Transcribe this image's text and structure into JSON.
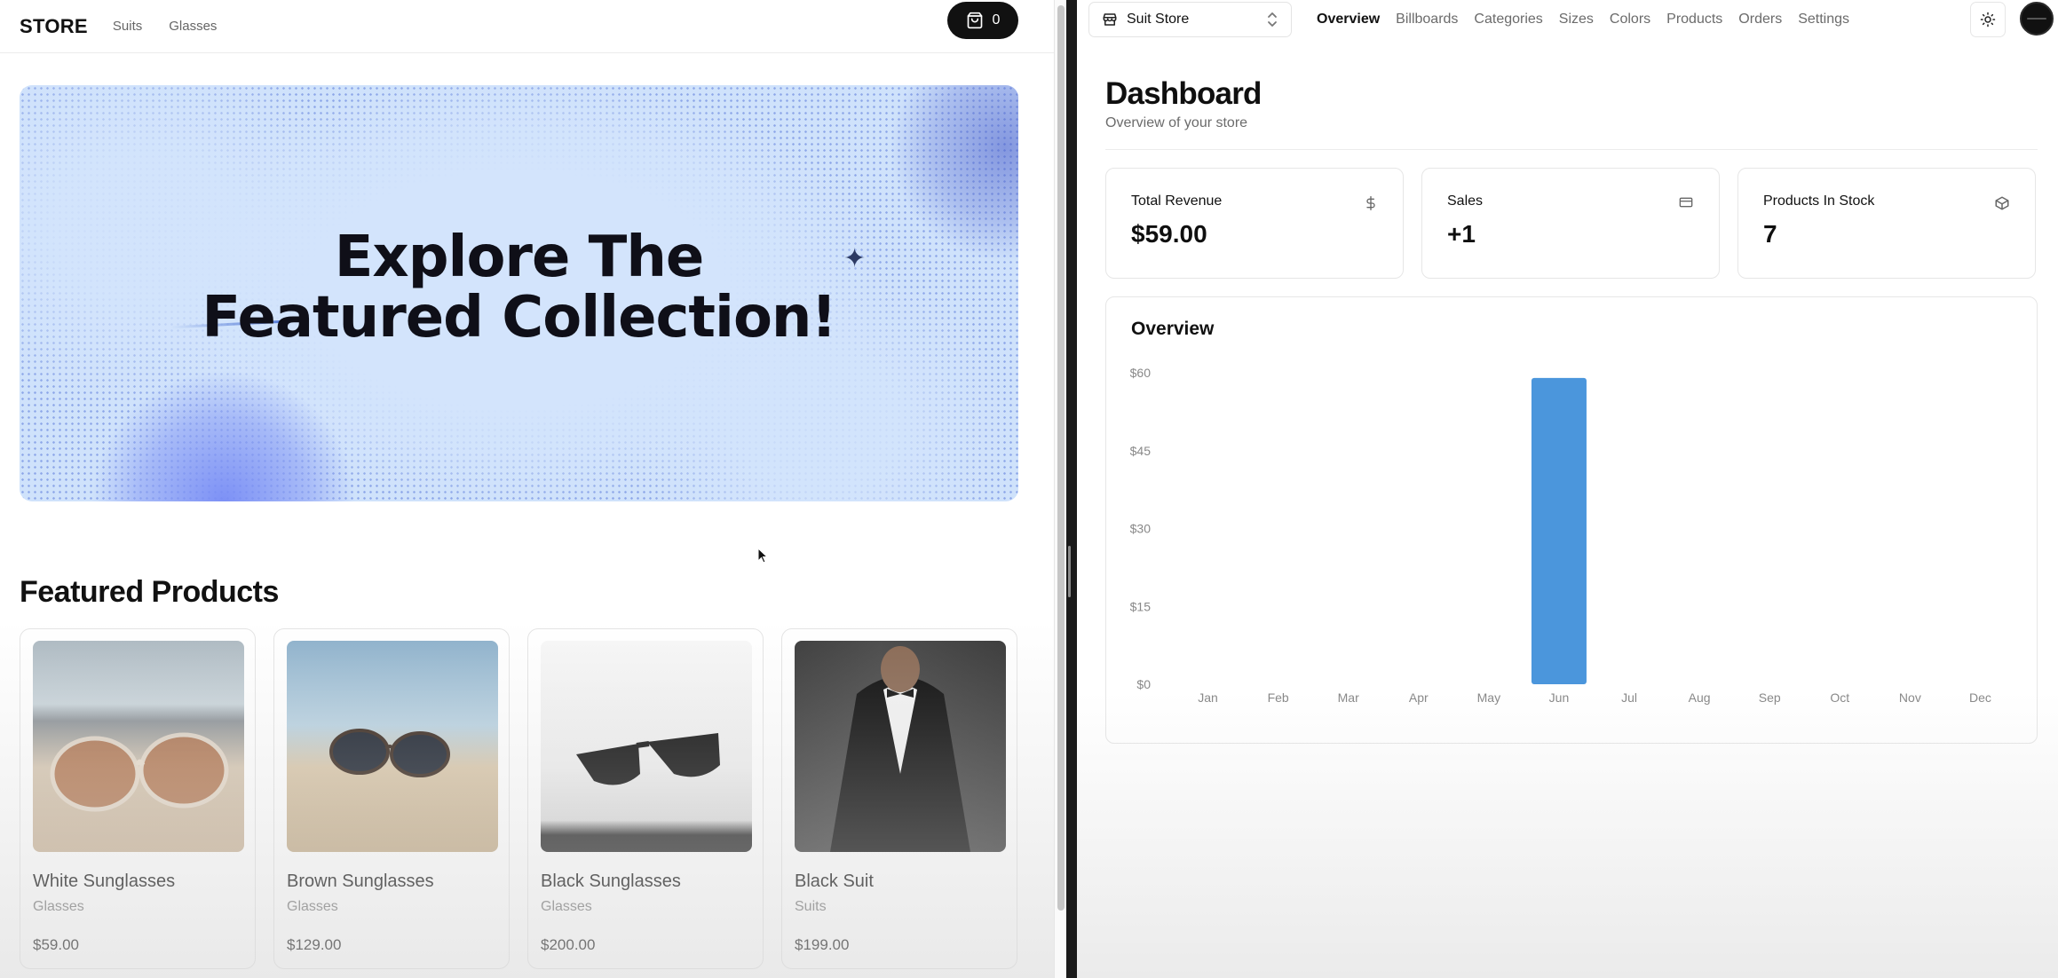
{
  "storefront": {
    "logo": "STORE",
    "nav": [
      "Suits",
      "Glasses"
    ],
    "cart_count": "0",
    "billboard": {
      "line1": "Explore The",
      "line2": "Featured Collection!"
    },
    "featured_title": "Featured Products",
    "products": [
      {
        "name": "White Sunglasses",
        "category": "Glasses",
        "price": "$59.00"
      },
      {
        "name": "Brown Sunglasses",
        "category": "Glasses",
        "price": "$129.00"
      },
      {
        "name": "Black Sunglasses",
        "category": "Glasses",
        "price": "$200.00"
      },
      {
        "name": "Black Suit",
        "category": "Suits",
        "price": "$199.00"
      }
    ]
  },
  "admin": {
    "store_switcher": "Suit Store",
    "nav": [
      {
        "label": "Overview",
        "active": true
      },
      {
        "label": "Billboards",
        "active": false
      },
      {
        "label": "Categories",
        "active": false
      },
      {
        "label": "Sizes",
        "active": false
      },
      {
        "label": "Colors",
        "active": false
      },
      {
        "label": "Products",
        "active": false
      },
      {
        "label": "Orders",
        "active": false
      },
      {
        "label": "Settings",
        "active": false
      }
    ],
    "title": "Dashboard",
    "subtitle": "Overview of your store",
    "stats": [
      {
        "title": "Total Revenue",
        "value": "$59.00",
        "icon": "dollar-icon"
      },
      {
        "title": "Sales",
        "value": "+1",
        "icon": "credit-card-icon"
      },
      {
        "title": "Products In Stock",
        "value": "7",
        "icon": "package-icon"
      }
    ],
    "overview_title": "Overview"
  },
  "chart_data": {
    "type": "bar",
    "categories": [
      "Jan",
      "Feb",
      "Mar",
      "Apr",
      "May",
      "Jun",
      "Jul",
      "Aug",
      "Sep",
      "Oct",
      "Nov",
      "Dec"
    ],
    "values": [
      0,
      0,
      0,
      0,
      0,
      59,
      0,
      0,
      0,
      0,
      0,
      0
    ],
    "yticks": [
      "$0",
      "$15",
      "$30",
      "$45",
      "$60"
    ],
    "ylim": [
      0,
      60
    ],
    "bar_color": "#4b96dc",
    "grid": false
  },
  "colors": {
    "accent": "#111111",
    "bar": "#4b96dc",
    "billboard": "#cfe2fb"
  }
}
